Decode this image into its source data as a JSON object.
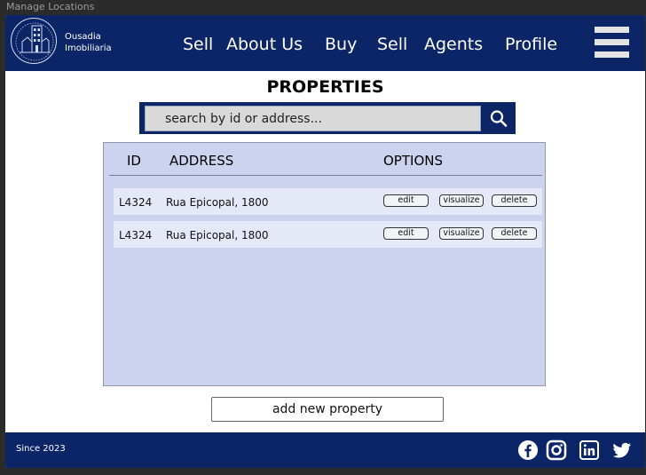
{
  "window": {
    "title": "Manage Locations"
  },
  "brand": {
    "line1": "Ousadia",
    "line2": "Imobiliaria",
    "logo_icon": "building-icon"
  },
  "nav": {
    "items": [
      {
        "label": "Sell"
      },
      {
        "label": "About Us"
      },
      {
        "label": "Buy"
      },
      {
        "label": "Sell"
      },
      {
        "label": "Agents"
      },
      {
        "label": "Profile"
      }
    ],
    "menu_icon": "hamburger-menu-icon"
  },
  "page": {
    "title": "PROPERTIES"
  },
  "search": {
    "placeholder": "search by id or address...",
    "icon": "search-icon"
  },
  "table": {
    "columns": {
      "id": "ID",
      "address": "ADDRESS",
      "options": "OPTIONS"
    },
    "rows": [
      {
        "id": "L4324",
        "address": "Rua Epicopal, 1800",
        "actions": {
          "edit": "edit",
          "visualize": "visualize",
          "delete": "delete"
        }
      },
      {
        "id": "L4324",
        "address": "Rua Epicopal, 1800",
        "actions": {
          "edit": "edit",
          "visualize": "visualize",
          "delete": "delete"
        }
      }
    ]
  },
  "add_button": {
    "label": "add new property"
  },
  "footer": {
    "since": "Since 2023",
    "social": [
      "facebook-icon",
      "instagram-icon",
      "linkedin-icon",
      "twitter-icon"
    ]
  },
  "colors": {
    "primary": "#0b2567",
    "panel": "#ccd3ef",
    "row": "#e4e8f7",
    "search_field": "#d9d9d9",
    "menu_bars": "#e3e3e3"
  }
}
